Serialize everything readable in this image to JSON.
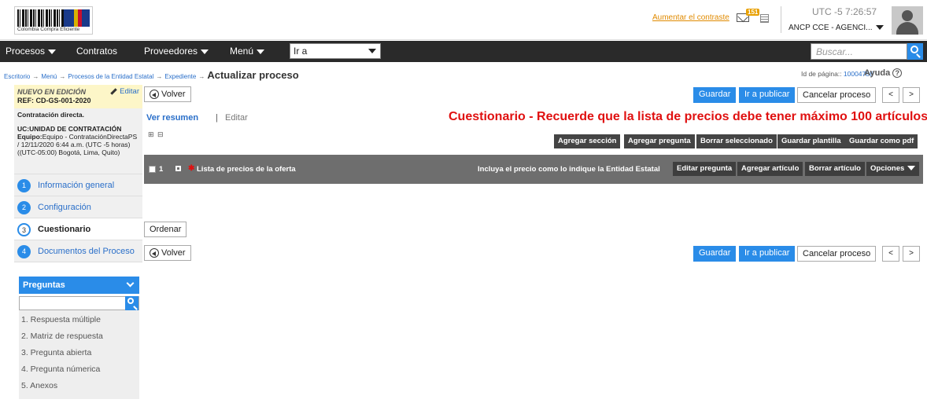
{
  "header": {
    "logo_text": "Colombia Compra Eficiente",
    "contrast_link": "Aumentar el contraste",
    "mail_count": "151",
    "time": "UTC -5 7:26:57",
    "account": "ANCP CCE - AGENCI..."
  },
  "nav": {
    "procesos": "Procesos",
    "contratos": "Contratos",
    "proveedores": "Proveedores",
    "menu": "Menú",
    "goto": "Ir a",
    "search_placeholder": "Buscar..."
  },
  "breadcrumb": {
    "items": [
      "Escritorio",
      "Menú",
      "Procesos de la Entidad Estatal",
      "Expediente"
    ],
    "current": "Actualizar proceso",
    "arrow": "→"
  },
  "page_id": {
    "label": "Id de página::",
    "value": "10004786",
    "help": "Ayuda"
  },
  "status": {
    "state": "NUEVO EN EDICIÓN",
    "ref": "REF: CD-GS-001-2020",
    "edit": "Editar"
  },
  "info": {
    "type": "Contratación directa.",
    "uc_label": "UC:",
    "uc": "UNIDAD DE CONTRATACIÓN",
    "team_label": "Equipo:",
    "team": "Equipo - ContrataciónDirectaPS / 12/11/2020 6:44 a.m. (UTC -5 horas)((UTC-05:00) Bogotá, Lima, Quito)"
  },
  "steps": [
    {
      "n": "1",
      "label": "Información general"
    },
    {
      "n": "2",
      "label": "Configuración"
    },
    {
      "n": "3",
      "label": "Cuestionario"
    },
    {
      "n": "4",
      "label": "Documentos del Proceso"
    }
  ],
  "preguntas": {
    "title": "Preguntas",
    "items": [
      "1. Respuesta múltiple",
      "2. Matriz de respuesta",
      "3. Pregunta abierta",
      "4. Pregunta númerica",
      "5. Anexos"
    ]
  },
  "actions": {
    "volver": "Volver",
    "guardar": "Guardar",
    "publicar": "Ir a publicar",
    "cancelar": "Cancelar proceso",
    "prev": "<",
    "next": ">",
    "ordenar": "Ordenar"
  },
  "tabs": {
    "resumen": "Ver resumen",
    "sep": "|",
    "editar": "Editar"
  },
  "warning": "Cuestionario - Recuerde que la lista de precios debe tener máximo 100 artículos",
  "expand": {
    "plus": "⊞",
    "minus": "⊟"
  },
  "toolbar": [
    "Agregar sección",
    "Agregar pregunta",
    "Borrar seleccionado",
    "Guardar plantilla",
    "Guardar como pdf"
  ],
  "question": {
    "num": "1",
    "req": "✱",
    "label": "Lista de precios de la oferta",
    "hint": "Incluya el precio como lo indique la Entidad Estatal",
    "buttons": [
      "Editar pregunta",
      "Agregar artículo",
      "Borrar artículo",
      "Opciones"
    ]
  }
}
